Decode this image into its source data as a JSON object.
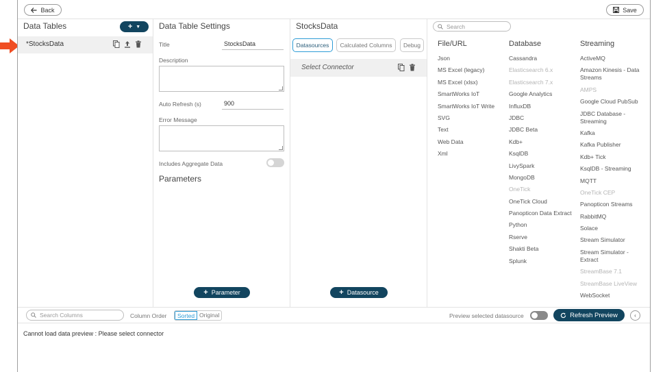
{
  "topbar": {
    "back_label": "Back",
    "save_label": "Save"
  },
  "data_tables": {
    "title": "Data Tables",
    "add_label": "+",
    "items": [
      {
        "name": "*StocksData"
      }
    ]
  },
  "settings": {
    "title": "Data Table Settings",
    "title_label": "Title",
    "title_value": "StocksData",
    "description_label": "Description",
    "auto_refresh_label": "Auto Refresh (s)",
    "auto_refresh_value": "900",
    "error_label": "Error Message",
    "aggregate_label": "Includes Aggregate Data",
    "parameters_title": "Parameters",
    "parameter_button": "Parameter"
  },
  "datasource_panel": {
    "title": "StocksData",
    "tabs": [
      "Datasources",
      "Calculated Columns",
      "Debug"
    ],
    "connector_label": "Select Connector",
    "datasource_button": "Datasource"
  },
  "connectors": {
    "search_placeholder": "Search",
    "columns": [
      {
        "heading": "File/URL",
        "items": [
          {
            "label": "Json",
            "enabled": true
          },
          {
            "label": "MS Excel (legacy)",
            "enabled": true
          },
          {
            "label": "MS Excel (xlsx)",
            "enabled": true
          },
          {
            "label": "SmartWorks IoT",
            "enabled": true
          },
          {
            "label": "SmartWorks IoT Write",
            "enabled": true
          },
          {
            "label": "SVG",
            "enabled": true
          },
          {
            "label": "Text",
            "enabled": true
          },
          {
            "label": "Web Data",
            "enabled": true
          },
          {
            "label": "Xml",
            "enabled": true
          }
        ]
      },
      {
        "heading": "Database",
        "items": [
          {
            "label": "Cassandra",
            "enabled": true
          },
          {
            "label": "Elasticsearch 6.x",
            "enabled": false
          },
          {
            "label": "Elasticsearch 7.x",
            "enabled": false
          },
          {
            "label": "Google Analytics",
            "enabled": true
          },
          {
            "label": "InfluxDB",
            "enabled": true
          },
          {
            "label": "JDBC",
            "enabled": true
          },
          {
            "label": "JDBC Beta",
            "enabled": true
          },
          {
            "label": "Kdb+",
            "enabled": true
          },
          {
            "label": "KsqlDB",
            "enabled": true
          },
          {
            "label": "LivySpark",
            "enabled": true
          },
          {
            "label": "MongoDB",
            "enabled": true
          },
          {
            "label": "OneTick",
            "enabled": false
          },
          {
            "label": "OneTick Cloud",
            "enabled": true
          },
          {
            "label": "Panopticon Data Extract",
            "enabled": true
          },
          {
            "label": "Python",
            "enabled": true
          },
          {
            "label": "Rserve",
            "enabled": true
          },
          {
            "label": "Shakti Beta",
            "enabled": true
          },
          {
            "label": "Splunk",
            "enabled": true
          }
        ]
      },
      {
        "heading": "Streaming",
        "items": [
          {
            "label": "ActiveMQ",
            "enabled": true
          },
          {
            "label": "Amazon Kinesis - Data Streams",
            "enabled": true
          },
          {
            "label": "AMPS",
            "enabled": false
          },
          {
            "label": "Google Cloud PubSub",
            "enabled": true
          },
          {
            "label": "JDBC Database - Streaming",
            "enabled": true
          },
          {
            "label": "Kafka",
            "enabled": true
          },
          {
            "label": "Kafka Publisher",
            "enabled": true
          },
          {
            "label": "Kdb+ Tick",
            "enabled": true
          },
          {
            "label": "KsqlDB - Streaming",
            "enabled": true
          },
          {
            "label": "MQTT",
            "enabled": true
          },
          {
            "label": "OneTick CEP",
            "enabled": false
          },
          {
            "label": "Panopticon Streams",
            "enabled": true
          },
          {
            "label": "RabbitMQ",
            "enabled": true
          },
          {
            "label": "Solace",
            "enabled": true
          },
          {
            "label": "Stream Simulator",
            "enabled": true
          },
          {
            "label": "Stream Simulator - Extract",
            "enabled": true
          },
          {
            "label": "StreamBase 7.1",
            "enabled": false
          },
          {
            "label": "StreamBase LiveView",
            "enabled": false
          },
          {
            "label": "WebSocket",
            "enabled": true
          }
        ]
      }
    ]
  },
  "bottombar": {
    "search_placeholder": "Search Columns",
    "column_order_label": "Column Order",
    "order_options": [
      "Sorted",
      "Original"
    ],
    "preview_label": "Preview selected datasource",
    "refresh_label": "Refresh Preview"
  },
  "message": "Cannot load data preview : Please select connector",
  "colors": {
    "accent": "#12455f",
    "tab_active": "#2c9bd6",
    "callout": "#f04e23"
  },
  "icons": [
    "back-arrow-icon",
    "save-icon",
    "plus-icon",
    "chevron-down-icon",
    "copy-icon",
    "upload-icon",
    "trash-icon",
    "search-icon",
    "refresh-icon",
    "chevron-left-icon",
    "callout-arrow-icon"
  ]
}
